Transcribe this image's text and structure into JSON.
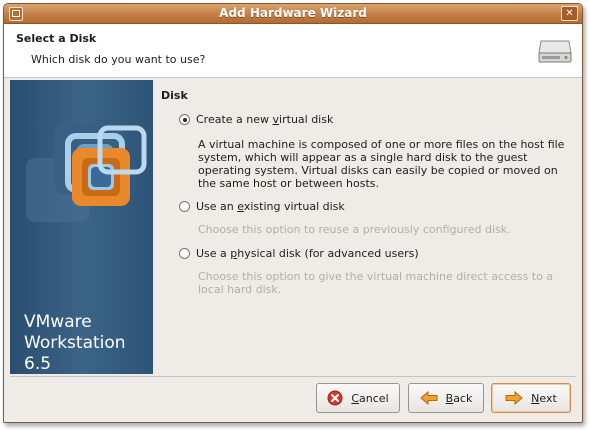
{
  "window": {
    "title": "Add Hardware Wizard"
  },
  "header": {
    "title": "Select a Disk",
    "subtitle": "Which disk do you want to use?"
  },
  "sidebar": {
    "product_line1": "VMware",
    "product_line2": "Workstation 6.5"
  },
  "section": {
    "title": "Disk"
  },
  "options": [
    {
      "label_pre": "Create a new ",
      "label_key": "v",
      "label_post": "irtual disk",
      "selected": true,
      "description": "A virtual machine is composed of one or more files on the host file system, which will appear as a single hard disk to the guest operating system. Virtual disks can easily be copied or moved on the same host or between hosts."
    },
    {
      "label_pre": "Use an ",
      "label_key": "e",
      "label_post": "xisting virtual disk",
      "selected": false,
      "description": "Choose this option to reuse a previously configured disk."
    },
    {
      "label_pre": "Use a ",
      "label_key": "p",
      "label_post": "hysical disk (for advanced users)",
      "selected": false,
      "description": "Choose this option to give the virtual machine direct access to a local hard disk."
    }
  ],
  "buttons": {
    "cancel_key": "C",
    "cancel_rest": "ancel",
    "back_key": "B",
    "back_rest": "ack",
    "next_key": "N",
    "next_rest": "ext"
  },
  "icons": {
    "window_menu": "window-menu-icon",
    "close": "close-icon",
    "disk": "hard-disk-icon",
    "logo": "vmware-logo",
    "cancel": "cancel-icon",
    "back": "back-arrow-icon",
    "next": "next-arrow-icon"
  },
  "colors": {
    "titlebar": "#c47e45",
    "sidebar": "#3b6487",
    "arrow": "#f0a030",
    "cancel_icon": "#d23a2a"
  }
}
